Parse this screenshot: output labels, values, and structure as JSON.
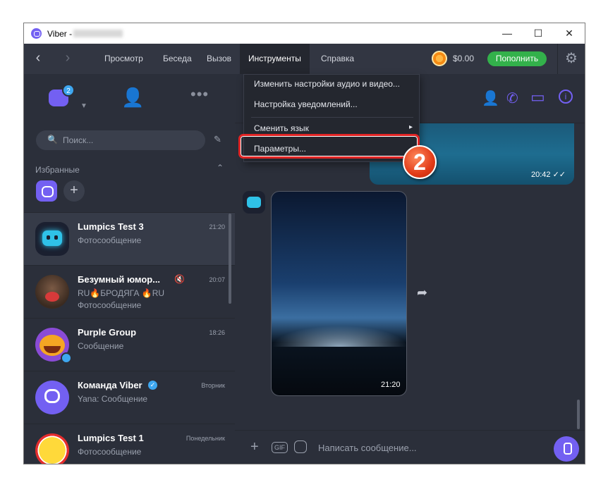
{
  "window": {
    "title": "Viber -",
    "minimize": "—",
    "maximize": "☐",
    "close": "✕"
  },
  "menu": {
    "back": "‹",
    "forward": "›",
    "items": [
      "Просмотр",
      "Беседа",
      "Вызов",
      "Инструменты",
      "Справка"
    ],
    "balance": "$0.00",
    "topup_label": "Пополнить"
  },
  "dropdown": {
    "items": [
      "Изменить настройки аудио и видео...",
      "Настройка уведомлений...",
      "Сменить язык",
      "Параметры..."
    ],
    "submenu_arrow": "▸"
  },
  "annotation_number": "2",
  "left": {
    "chat_badge": "2",
    "search_placeholder": "Поиск...",
    "favorites_label": "Избранные",
    "chats": [
      {
        "name": "Lumpics Test 3",
        "message": "Фотосообщение",
        "time": "21:20"
      },
      {
        "name": "Безумный юмор...",
        "message": "RU🔥БРОДЯГА 🔥RU",
        "message2": "Фотосообщение",
        "time": "20:07"
      },
      {
        "name": "Purple Group",
        "message": "Сообщение",
        "time": "18:26"
      },
      {
        "name": "Команда Viber",
        "message": "Yana: Сообщение",
        "time": "Вторник"
      },
      {
        "name": "Lumpics Test 1",
        "message": "Фотосообщение",
        "time": "Понедельник"
      }
    ]
  },
  "conversation": {
    "top_image_time": "20:42 ✓✓",
    "photo_time": "21:20",
    "composer_placeholder": "Написать сообщение...",
    "gif_label": "GIF"
  },
  "colors": {
    "accent": "#7360f2",
    "topup": "#33b14b",
    "highlight": "#e02424"
  }
}
